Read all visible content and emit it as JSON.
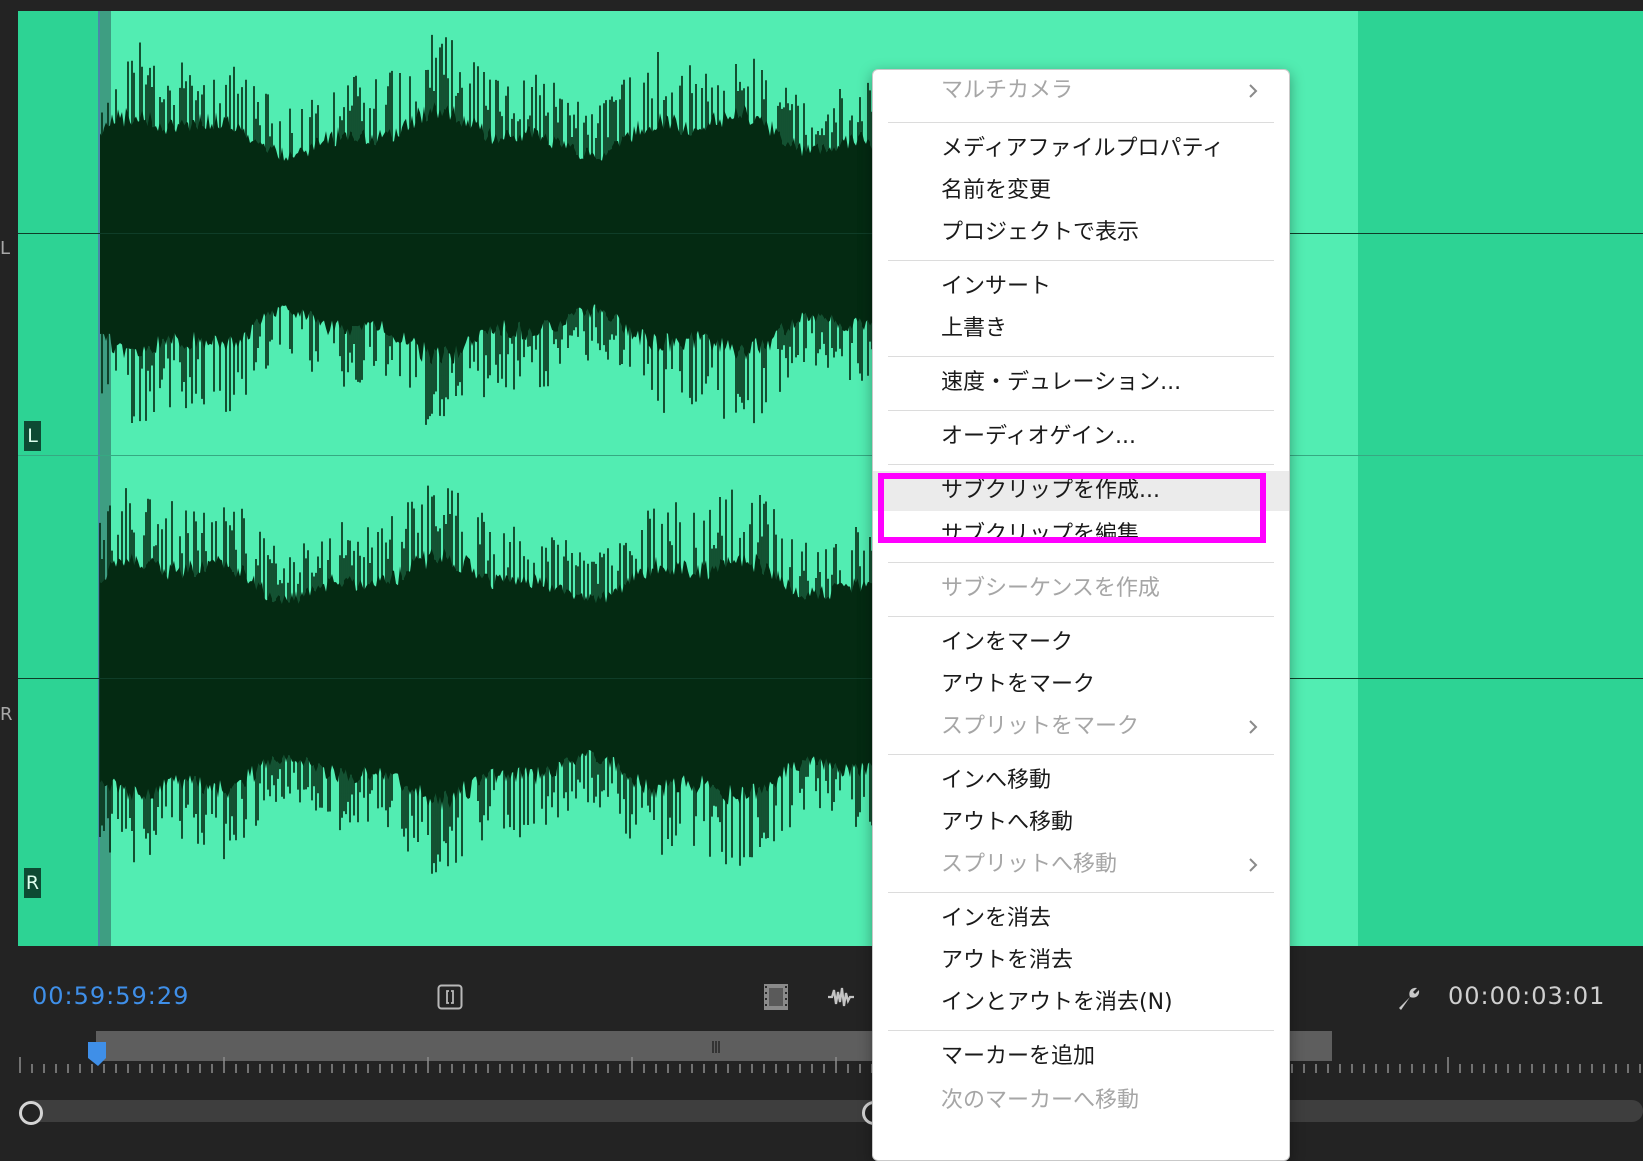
{
  "waveform": {
    "channels": [
      "L",
      "R"
    ],
    "side_labels": [
      "L",
      "R"
    ]
  },
  "timecode": {
    "playhead": "00:59:59:29",
    "duration": "00:00:03:01"
  },
  "context_menu": {
    "items": [
      {
        "label": "マルチカメラ",
        "enabled": false,
        "submenu": true
      },
      {
        "label": "メディアファイルプロパティ",
        "enabled": true,
        "submenu": false
      },
      {
        "label": "名前を変更",
        "enabled": true,
        "submenu": false
      },
      {
        "label": "プロジェクトで表示",
        "enabled": true,
        "submenu": false
      },
      {
        "label": "インサート",
        "enabled": true,
        "submenu": false
      },
      {
        "label": "上書き",
        "enabled": true,
        "submenu": false
      },
      {
        "label": "速度・デュレーション...",
        "enabled": true,
        "submenu": false
      },
      {
        "label": "オーディオゲイン...",
        "enabled": true,
        "submenu": false
      },
      {
        "label": "サブクリップを作成...",
        "enabled": true,
        "submenu": false,
        "highlighted": true
      },
      {
        "label": "サブクリップを編集...",
        "enabled": true,
        "submenu": false
      },
      {
        "label": "サブシーケンスを作成",
        "enabled": false,
        "submenu": false
      },
      {
        "label": "インをマーク",
        "enabled": true,
        "submenu": false
      },
      {
        "label": "アウトをマーク",
        "enabled": true,
        "submenu": false
      },
      {
        "label": "スプリットをマーク",
        "enabled": false,
        "submenu": true
      },
      {
        "label": "インへ移動",
        "enabled": true,
        "submenu": false
      },
      {
        "label": "アウトへ移動",
        "enabled": true,
        "submenu": false
      },
      {
        "label": "スプリットへ移動",
        "enabled": false,
        "submenu": true
      },
      {
        "label": "インを消去",
        "enabled": true,
        "submenu": false
      },
      {
        "label": "アウトを消去",
        "enabled": true,
        "submenu": false
      },
      {
        "label": "インとアウトを消去(N)",
        "enabled": true,
        "submenu": false
      },
      {
        "label": "マーカーを追加",
        "enabled": true,
        "submenu": false
      },
      {
        "label": "次のマーカーへ移動",
        "enabled": false,
        "submenu": false
      }
    ]
  },
  "icons": {
    "in_bracket": "in-out-bracket-icon",
    "video_only": "film-strip-icon",
    "audio_only": "waveform-icon",
    "settings": "wrench-icon"
  },
  "colors": {
    "waveform_bg": "#52edb2",
    "waveform_dark": "#2dd394",
    "waveform_ink": "#042a12",
    "timecode_blue": "#3f8fe8",
    "highlight": "#ff00ff"
  }
}
